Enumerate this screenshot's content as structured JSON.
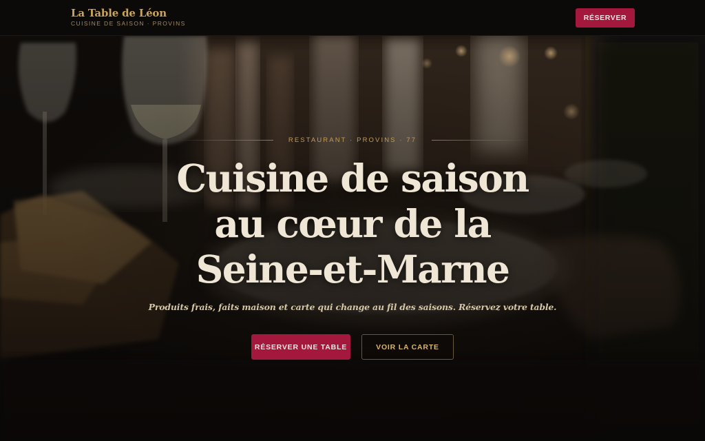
{
  "header": {
    "brand_name": "La Table de Léon",
    "brand_tagline": "CUISINE DE SAISON · PROVINS",
    "reserve_label": "RÉSERVER"
  },
  "hero": {
    "eyebrow": "RESTAURANT · PROVINS · 77",
    "headline_lines": [
      "Cuisine de saison",
      "au cœur de la",
      "Seine-et-Marne"
    ],
    "subline": "Produits frais, faits maison et carte qui change au fil des saisons. Réservez votre table.",
    "primary_cta": "RÉSERVER UNE TABLE",
    "secondary_cta": "VOIR LA CARTE"
  },
  "colors": {
    "accent": "#a3183c",
    "gold": "#c9a45c",
    "header_bg": "#0c0a08",
    "headline": "#efe6d6"
  }
}
